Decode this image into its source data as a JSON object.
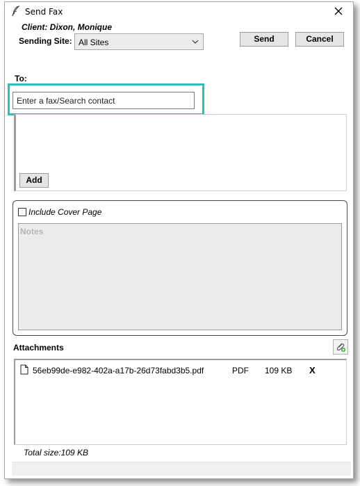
{
  "window": {
    "title": "Send Fax",
    "title_icon": "quill-pen-icon",
    "close_icon": "close-icon"
  },
  "client": {
    "text": "Client: Dixon, Monique"
  },
  "sending_site": {
    "label": "Sending Site:",
    "selected": "All Sites"
  },
  "actions": {
    "send_label": "Send",
    "cancel_label": "Cancel"
  },
  "to": {
    "label": "To:",
    "placeholder": "Enter a fax/Search contact",
    "add_label": "Add"
  },
  "cover": {
    "include_label": "Include Cover Page",
    "checked": false,
    "notes_placeholder": "Notes"
  },
  "attachments": {
    "label": "Attachments",
    "files": [
      {
        "name": "56eb99de-e982-402a-a17b-26d73fabd3b5.pdf",
        "type": "PDF",
        "size": "109 KB",
        "remove": "X"
      }
    ],
    "total": "Total size:109 KB"
  },
  "colors": {
    "highlight": "#25c0c0",
    "button_bg": "#e5e5e5",
    "notes_bg": "#ececec"
  }
}
